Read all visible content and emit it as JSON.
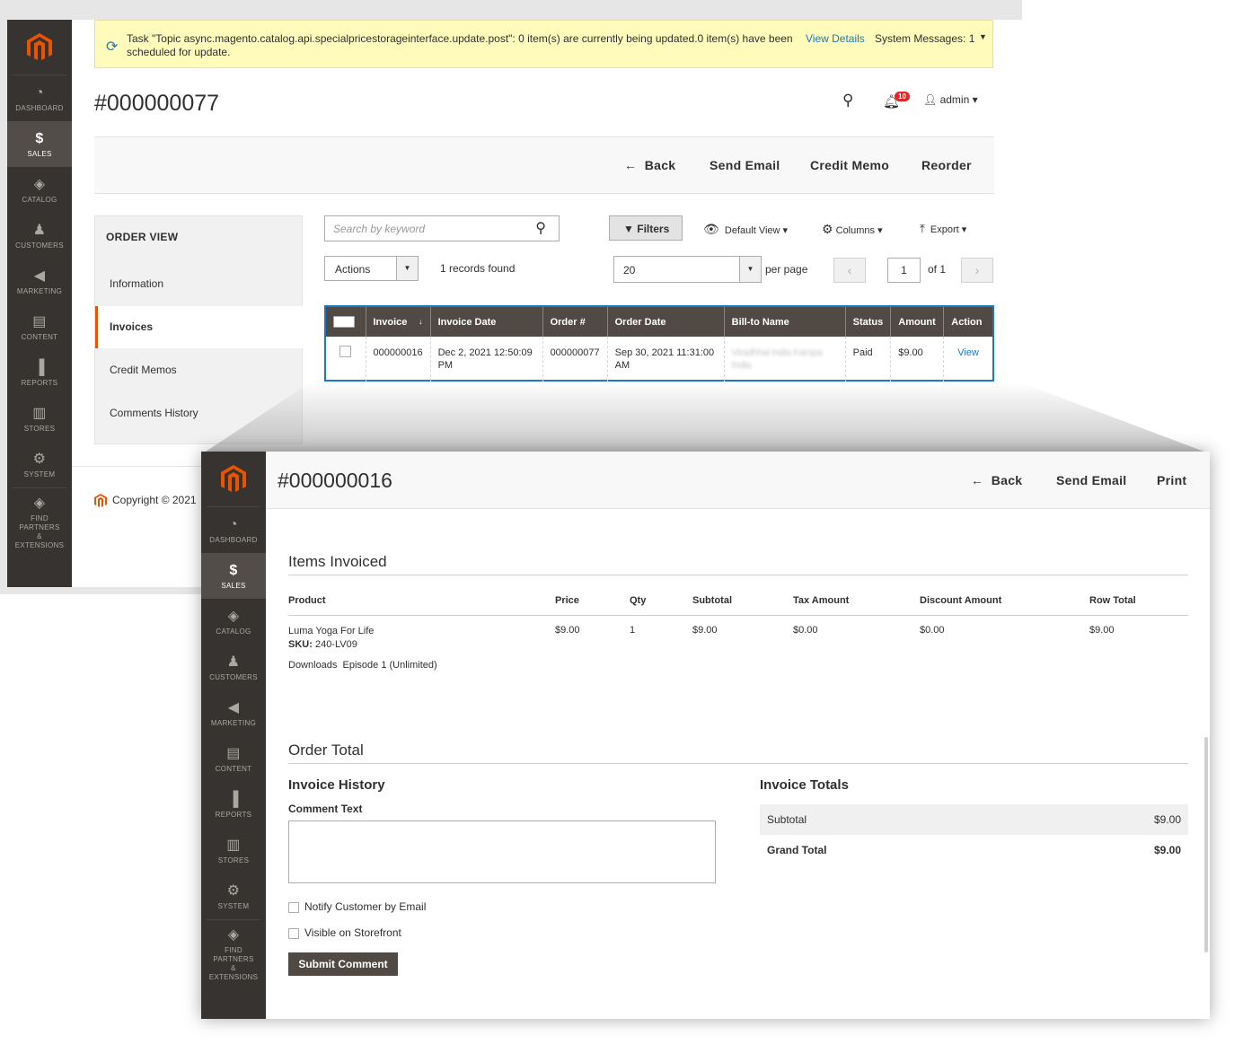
{
  "nav": {
    "items": [
      {
        "label": "DASHBOARD",
        "icon": "dashboard-icon",
        "glyph": "◔"
      },
      {
        "label": "SALES",
        "icon": "dollar-icon",
        "glyph": "$"
      },
      {
        "label": "CATALOG",
        "icon": "cube-icon",
        "glyph": "◈"
      },
      {
        "label": "CUSTOMERS",
        "icon": "person-icon",
        "glyph": "♟"
      },
      {
        "label": "MARKETING",
        "icon": "megaphone-icon",
        "glyph": "◀"
      },
      {
        "label": "CONTENT",
        "icon": "layout-icon",
        "glyph": "▤"
      },
      {
        "label": "REPORTS",
        "icon": "bar-chart-icon",
        "glyph": "▐"
      },
      {
        "label": "STORES",
        "icon": "store-icon",
        "glyph": "▥"
      },
      {
        "label": "SYSTEM",
        "icon": "gear-icon",
        "glyph": "⚙"
      }
    ],
    "partners_line1": "FIND PARTNERS",
    "partners_line2": "& EXTENSIONS"
  },
  "system_message": {
    "text": "Task \"Topic async.magento.catalog.api.specialpricestorageinterface.update.post\": 0 item(s) are currently being updated.0 item(s) have been scheduled for update.",
    "view_details": "View Details",
    "system_messages": "System Messages: 1"
  },
  "order": {
    "title": "#000000077",
    "actions": {
      "back": "Back",
      "send_email": "Send Email",
      "credit_memo": "Credit Memo",
      "reorder": "Reorder"
    },
    "header": {
      "badge": "10",
      "user": "admin"
    },
    "order_view": {
      "title": "ORDER VIEW",
      "tabs": [
        "Information",
        "Invoices",
        "Credit Memos",
        "Comments History"
      ]
    },
    "toolbar": {
      "search_placeholder": "Search by keyword",
      "filters": "Filters",
      "default_view": "Default View",
      "columns": "Columns",
      "export": "Export",
      "actions": "Actions",
      "records": "1 records found",
      "per_page_value": "20",
      "per_page": "per page",
      "page": "1",
      "of": "of 1"
    },
    "grid": {
      "columns": [
        "Invoice",
        "Invoice Date",
        "Order #",
        "Order Date",
        "Bill-to Name",
        "Status",
        "Amount",
        "Action"
      ],
      "row": {
        "invoice": "000000016",
        "invoice_date": "Dec 2, 2021 12:50:09 PM",
        "order_no": "000000077",
        "order_date": "Sep 30, 2021 11:31:00 AM",
        "bill_to": "Viradhhai India Kampa India",
        "status": "Paid",
        "amount": "$9.00",
        "action": "View"
      }
    },
    "copyright": "Copyright © 2021"
  },
  "invoice": {
    "title": "#000000016",
    "actions": {
      "back": "Back",
      "send_email": "Send Email",
      "print": "Print"
    },
    "items_invoiced": "Items Invoiced",
    "columns": [
      "Product",
      "Price",
      "Qty",
      "Subtotal",
      "Tax Amount",
      "Discount Amount",
      "Row Total"
    ],
    "item": {
      "product": "Luma Yoga For Life",
      "sku_label": "SKU:",
      "sku": "240-LV09",
      "downloads": "Downloads  Episode 1 (Unlimited)",
      "price": "$9.00",
      "qty": "1",
      "subtotal": "$9.00",
      "tax": "$0.00",
      "discount": "$0.00",
      "row_total": "$9.00"
    },
    "order_total": "Order Total",
    "invoice_history": "Invoice History",
    "comment_text": "Comment Text",
    "notify": "Notify Customer by Email",
    "visible": "Visible on Storefront",
    "submit": "Submit Comment",
    "invoice_totals": "Invoice Totals",
    "subtotal_label": "Subtotal",
    "subtotal_value": "$9.00",
    "grand_total_label": "Grand Total",
    "grand_total_value": "$9.00"
  },
  "colors": {
    "accent": "#eb5202",
    "sidebar": "#373330",
    "link": "#1979c3",
    "header_row": "#514943"
  }
}
